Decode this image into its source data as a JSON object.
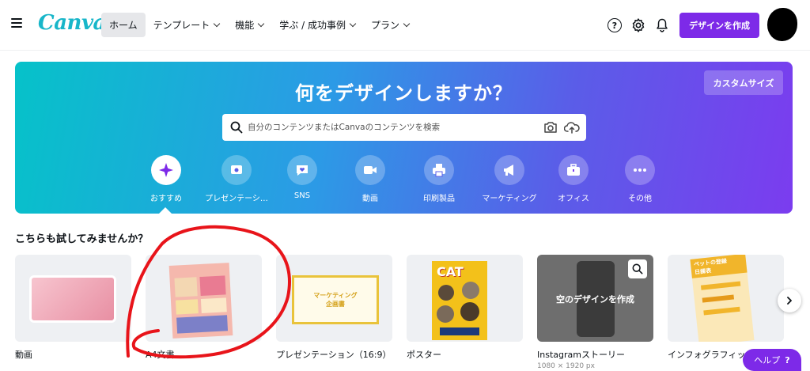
{
  "header": {
    "logo": "Canva",
    "nav": [
      {
        "label": "ホーム",
        "active": true,
        "dropdown": false
      },
      {
        "label": "テンプレート",
        "active": false,
        "dropdown": true
      },
      {
        "label": "機能",
        "active": false,
        "dropdown": true
      },
      {
        "label": "学ぶ / 成功事例",
        "active": false,
        "dropdown": true
      },
      {
        "label": "プラン",
        "active": false,
        "dropdown": true
      }
    ],
    "help_icon": "?",
    "create_button": "デザインを作成"
  },
  "hero": {
    "title": "何をデザインしますか？",
    "custom_size_button": "カスタムサイズ",
    "search": {
      "placeholder": "自分のコンテンツまたはCanvaのコンテンツを検索"
    },
    "categories": [
      {
        "label": "おすすめ",
        "icon": "sparkle-icon",
        "active": true
      },
      {
        "label": "プレゼンテーシ…",
        "icon": "presentation-icon",
        "active": false
      },
      {
        "label": "SNS",
        "icon": "heart-chat-icon",
        "active": false
      },
      {
        "label": "動画",
        "icon": "video-camera-icon",
        "active": false
      },
      {
        "label": "印刷製品",
        "icon": "printer-icon",
        "active": false
      },
      {
        "label": "マーケティング",
        "icon": "megaphone-icon",
        "active": false
      },
      {
        "label": "オフィス",
        "icon": "briefcase-icon",
        "active": false
      },
      {
        "label": "その他",
        "icon": "more-icon",
        "active": false
      }
    ]
  },
  "suggestions": {
    "title": "こちらも試してみませんか？",
    "cards": [
      {
        "label": "動画",
        "sub": ""
      },
      {
        "label": "A4文書",
        "sub": ""
      },
      {
        "label": "プレゼンテーション（16:9）",
        "sub": ""
      },
      {
        "label": "ポスター",
        "sub": ""
      },
      {
        "label": "Instagramストーリー",
        "sub": "1080 × 1920 px",
        "overlay": "空のデザインを作成"
      },
      {
        "label": "インフォグラフィック",
        "sub": ""
      }
    ],
    "thumb_texts": {
      "presentation_title": "マーケティング\n企画書",
      "poster_title": "CAT",
      "infographic_title": "ペットの登録\n日課表"
    }
  },
  "help_fab": {
    "label": "ヘルプ",
    "icon": "?"
  },
  "colors": {
    "brand": "#7d2ae8",
    "logo": "#18b6c9",
    "annotation": "#e8141a"
  }
}
